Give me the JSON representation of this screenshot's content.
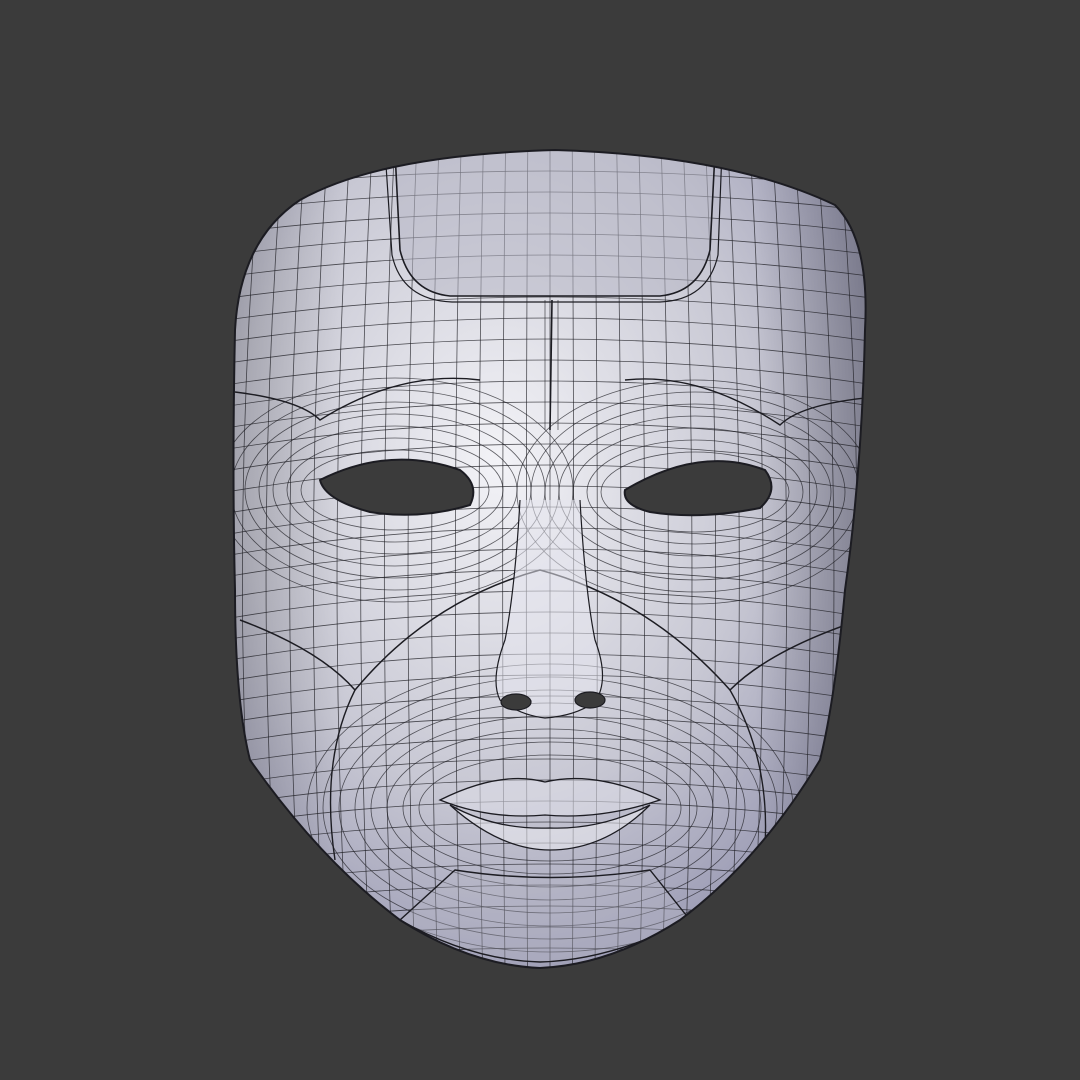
{
  "scene": {
    "background_color": "#3b3b3b",
    "subject": "mask-3d-wireframe",
    "colors": {
      "surface_light": "#f3f3f7",
      "surface_mid": "#c7c7d3",
      "surface_shadow": "#8a8aa8",
      "wire": "#1c1c22",
      "hole": "#3b3b3b"
    }
  }
}
